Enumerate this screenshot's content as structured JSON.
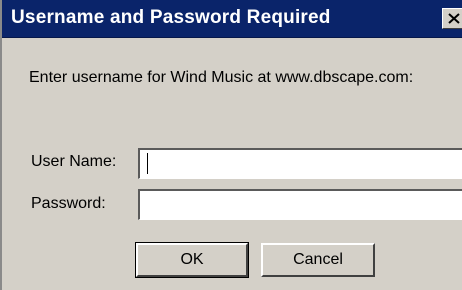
{
  "dialog": {
    "title": "Username and Password Required",
    "close_icon": "close-icon",
    "prompt": "Enter username for Wind Music at www.dbscape.com:",
    "fields": {
      "username": {
        "label": "User Name:",
        "value": "",
        "placeholder": ""
      },
      "password": {
        "label": "Password:",
        "value": "",
        "placeholder": ""
      }
    },
    "buttons": {
      "ok": "OK",
      "cancel": "Cancel"
    }
  },
  "colors": {
    "titlebar": "#0a246a",
    "dialog_bg": "#d4d0c8"
  }
}
